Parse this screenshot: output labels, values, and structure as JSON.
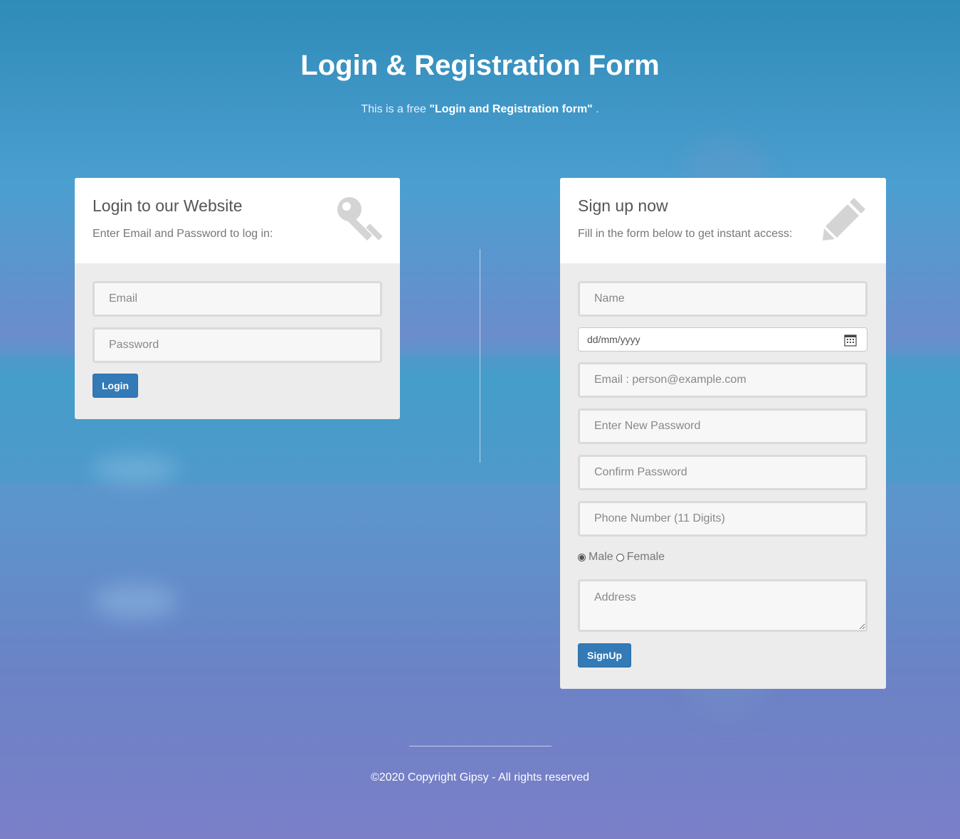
{
  "header": {
    "title": "Login & Registration Form",
    "subtitle_prefix": "This is a free ",
    "subtitle_bold": "\"Login and Registration form\"",
    "subtitle_suffix": " ."
  },
  "login": {
    "title": "Login to our Website",
    "description": "Enter Email and Password to log in:",
    "email_placeholder": "Email",
    "password_placeholder": "Password",
    "button_label": "Login",
    "icon": "key-icon"
  },
  "signup": {
    "title": "Sign up now",
    "description": "Fill in the form below to get instant access:",
    "name_placeholder": "Name",
    "date_value": "dd/mm/yyyy",
    "email_placeholder": "Email : person@example.com",
    "password_placeholder": "Enter New Password",
    "confirm_placeholder": "Confirm Password",
    "phone_placeholder": "Phone Number (11 Digits)",
    "gender_male": "Male",
    "gender_female": "Female",
    "gender_selected": "Male",
    "address_placeholder": "Address",
    "button_label": "SignUp",
    "icon": "pencil-icon"
  },
  "footer": {
    "copyright": "©2020 Copyright Gipsy - All rights reserved"
  },
  "colors": {
    "accent": "#337ab7"
  }
}
